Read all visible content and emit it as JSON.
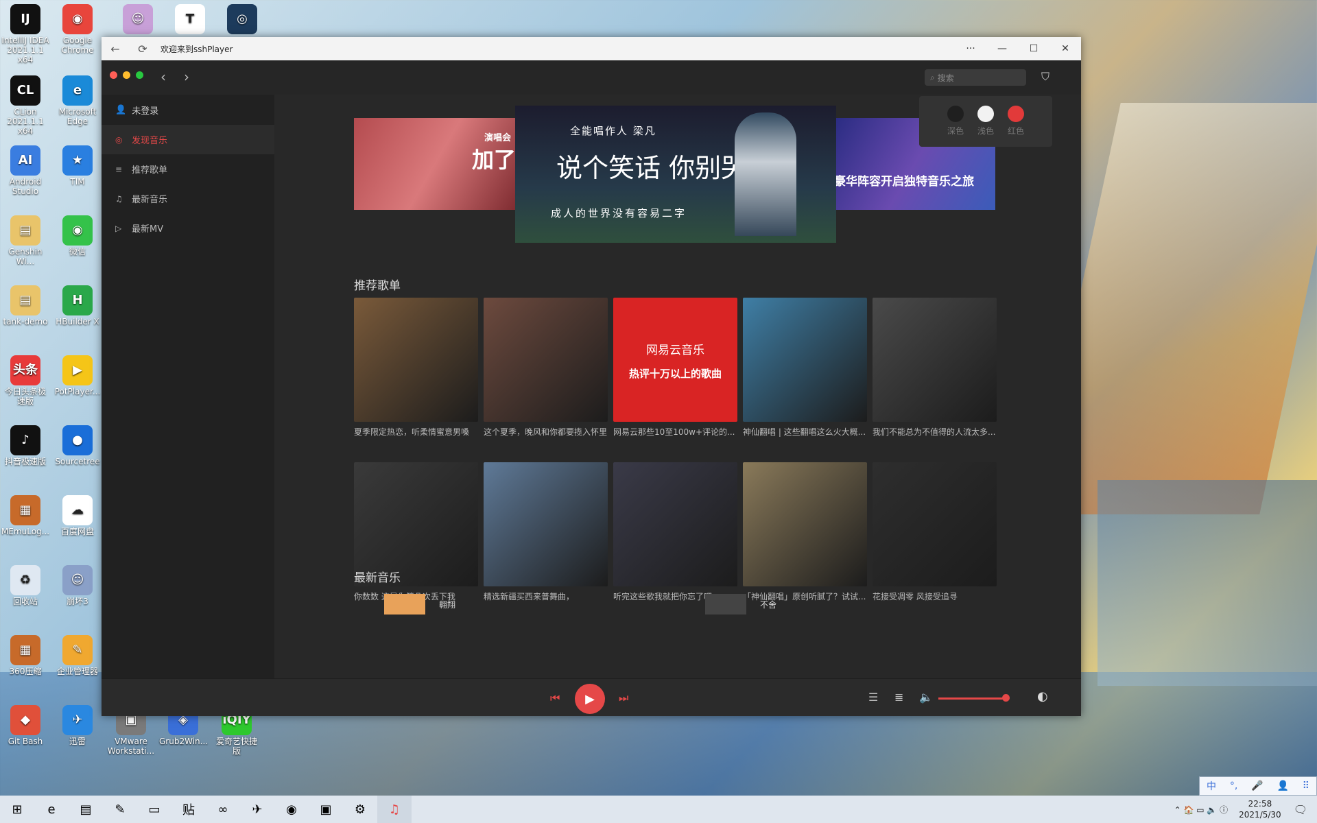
{
  "desktop": {
    "icons": [
      {
        "label": "IntelliJ IDEA 2021.1.1 x64",
        "glyph": "IJ",
        "color": "#111111"
      },
      {
        "label": "Google Chrome",
        "glyph": "◉",
        "color": "#e8453c"
      },
      {
        "label": "",
        "glyph": "☺",
        "color": "#c8a0d8"
      },
      {
        "label": "",
        "glyph": "T",
        "color": "#ffffff"
      },
      {
        "label": "",
        "glyph": "◎",
        "color": "#1d3b5c"
      },
      {
        "label": "CLion 2021.1.1 x64",
        "glyph": "CL",
        "color": "#111111"
      },
      {
        "label": "Microsoft Edge",
        "glyph": "e",
        "color": "#1a8ad8"
      },
      {
        "label": "Android Studio",
        "glyph": "AI",
        "color": "#3a7de0"
      },
      {
        "label": "TIM",
        "glyph": "★",
        "color": "#2a7fe0"
      },
      {
        "label": "Genshin Wi...",
        "glyph": "▤",
        "color": "#e9c46a"
      },
      {
        "label": "微信",
        "glyph": "◉",
        "color": "#34c24a"
      },
      {
        "label": "tank-demo",
        "glyph": "▤",
        "color": "#e9c46a"
      },
      {
        "label": "HBuilder X",
        "glyph": "H",
        "color": "#2aa84a"
      },
      {
        "label": "今日头条极速版",
        "glyph": "头条",
        "color": "#e83a3a"
      },
      {
        "label": "PotPlayer...",
        "glyph": "▶",
        "color": "#f5c518"
      },
      {
        "label": "抖音极速版",
        "glyph": "♪",
        "color": "#111111"
      },
      {
        "label": "Sourcetree",
        "glyph": "●",
        "color": "#1a6ed8"
      },
      {
        "label": "MEmuLog...",
        "glyph": "▦",
        "color": "#c76a2a"
      },
      {
        "label": "百度网盘",
        "glyph": "☁",
        "color": "#ffffff"
      },
      {
        "label": "回收站",
        "glyph": "♻",
        "color": "#dfe8f2"
      },
      {
        "label": "崩坏3",
        "glyph": "☺",
        "color": "#8aa0c8"
      },
      {
        "label": "360压缩",
        "glyph": "▦",
        "color": "#c76a2a"
      },
      {
        "label": "企业管理器",
        "glyph": "✎",
        "color": "#f0a830"
      },
      {
        "label": "Git Bash",
        "glyph": "◆",
        "color": "#e0503a"
      },
      {
        "label": "迅雷",
        "glyph": "✈",
        "color": "#2a88e0"
      },
      {
        "label": "VMware Workstati...",
        "glyph": "▣",
        "color": "#7a7a7a"
      },
      {
        "label": "Grub2Win...",
        "glyph": "◈",
        "color": "#3a6fd8"
      },
      {
        "label": "爱奇艺快捷版",
        "glyph": "iQIY",
        "color": "#2ec82e"
      }
    ]
  },
  "window": {
    "title": "欢迎来到sshPlayer",
    "back_icon": "←",
    "refresh_icon": "⟳",
    "more_icon": "···",
    "min_icon": "—",
    "max_icon": "☐",
    "close_icon": "✕"
  },
  "app": {
    "search_placeholder": "搜索",
    "search_icon": "⌕",
    "skin_icon": "⛉",
    "nav_back": "‹",
    "nav_forward": "›",
    "themes": [
      {
        "label": "深色",
        "color": "#1f1f1f"
      },
      {
        "label": "浅色",
        "color": "#f2f2f2"
      },
      {
        "label": "红色",
        "color": "#e23a3a"
      }
    ],
    "sidebar": {
      "user": "未登录",
      "items": [
        {
          "label": "发现音乐",
          "icon": "◎",
          "active": true
        },
        {
          "label": "推荐歌单",
          "icon": "≡",
          "active": false
        },
        {
          "label": "最新音乐",
          "icon": "♫",
          "active": false
        },
        {
          "label": "最新MV",
          "icon": "▷",
          "active": false
        }
      ]
    },
    "banner": {
      "left_text": "加了",
      "left_small": "演唱会",
      "center_artist": "全能唱作人  梁凡",
      "center_title": "说个笑话 你别哭",
      "center_sub": "成人的世界没有容易二字",
      "right_text": "豪华阵容开启独特音乐之旅",
      "indicator_count": 10,
      "active_index": 9
    },
    "sections": {
      "playlists_title": "推荐歌单",
      "newsongs_title": "最新音乐"
    },
    "playlists": [
      {
        "label": "夏季限定热恋，听柔情蜜意男嗓",
        "color": "#7a5a3a"
      },
      {
        "label": "这个夏季，晚风和你都要揽入怀里",
        "color": "#6d4a3e"
      },
      {
        "label": "网易云那些10至100w+评论的...",
        "color": "#d92424"
      },
      {
        "label": "神仙翻唱 | 这些翻唱这么火大概...",
        "color": "#3f7fa6"
      },
      {
        "label": "我们不能总为不值得的人流太多...",
        "color": "#4a4a4a"
      },
      {
        "label": "你数数 这是你第几次丢下我",
        "color": "#3a3a3a"
      },
      {
        "label": "精选新疆买西来普舞曲，",
        "color": "#5f7a98"
      },
      {
        "label": "听完这些歌我就把你忘了吧",
        "color": "#3a3a48"
      },
      {
        "label": "「神仙翻唱」原创听腻了？试试...",
        "color": "#8a7a5a"
      },
      {
        "label": "花接受凋零 风接受追寻",
        "color": "#2e2e2e"
      }
    ],
    "netease_logo": "网易云音乐",
    "netease_caption": "热评十万以上的歌曲",
    "new_songs": [
      {
        "title": "翱翔",
        "color": "#e8a25a"
      },
      {
        "title": "不舍",
        "color": "#444444"
      }
    ],
    "player": {
      "prev_icon": "⏮",
      "play_icon": "▶",
      "next_icon": "⏭",
      "playlist_icon": "☰",
      "lyrics_icon": "≣",
      "volume_icon": "🔈",
      "github_icon": "◐",
      "volume": 1.0
    }
  },
  "taskbar": {
    "apps": [
      "⊞",
      "e",
      "▤",
      "✎",
      "▭",
      "贴",
      "∞",
      "✈",
      "◉",
      "▣",
      "⚙",
      "♫"
    ],
    "tray_icons": "⌃ 🏠 ▭ 🔈 ⓘ",
    "time": "22:58",
    "date": "2021/5/30",
    "ime": [
      "中",
      "°,",
      "🎤",
      "👤",
      "⠿"
    ]
  }
}
